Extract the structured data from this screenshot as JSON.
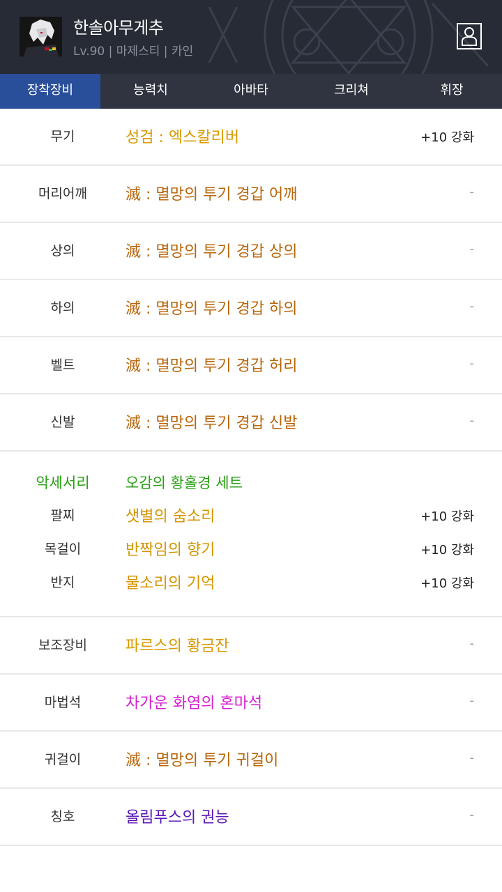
{
  "header": {
    "character_name": "한솔아무게추",
    "character_info": "Lv.90 | 마제스티 | 카인",
    "avatar_icon": "character-portrait-icon",
    "profile_icon": "profile-person-icon"
  },
  "tabs": [
    {
      "label": "장착장비",
      "active": true
    },
    {
      "label": "능력치",
      "active": false
    },
    {
      "label": "아바타",
      "active": false
    },
    {
      "label": "크리쳐",
      "active": false
    },
    {
      "label": "휘장",
      "active": false
    }
  ],
  "equipment": {
    "weapon": {
      "slot": "무기",
      "name": "성검 : 엑스칼리버",
      "upgrade": "+10 강화"
    },
    "shoulder": {
      "slot": "머리어깨",
      "name": "滅 : 멸망의 투기 경갑 어깨",
      "upgrade": "-"
    },
    "top": {
      "slot": "상의",
      "name": "滅 : 멸망의 투기 경갑 상의",
      "upgrade": "-"
    },
    "bottom": {
      "slot": "하의",
      "name": "滅 : 멸망의 투기 경갑 하의",
      "upgrade": "-"
    },
    "belt": {
      "slot": "벨트",
      "name": "滅 : 멸망의 투기 경갑 허리",
      "upgrade": "-"
    },
    "shoes": {
      "slot": "신발",
      "name": "滅 : 멸망의 투기 경갑 신발",
      "upgrade": "-"
    }
  },
  "accessory": {
    "slot": "악세서리",
    "set_name": "오감의 황홀경 세트",
    "items": [
      {
        "slot": "팔찌",
        "name": "샛별의 숨소리",
        "upgrade": "+10 강화"
      },
      {
        "slot": "목걸이",
        "name": "반짝임의 향기",
        "upgrade": "+10 강화"
      },
      {
        "slot": "반지",
        "name": "물소리의 기억",
        "upgrade": "+10 강화"
      }
    ]
  },
  "extra": {
    "sub": {
      "slot": "보조장비",
      "name": "파르스의 황금잔",
      "upgrade": "-"
    },
    "magicstone": {
      "slot": "마법석",
      "name": "차가운 화염의 혼마석",
      "upgrade": "-"
    },
    "earring": {
      "slot": "귀걸이",
      "name": "滅 : 멸망의 투기 귀걸이",
      "upgrade": "-"
    },
    "title": {
      "slot": "칭호",
      "name": "올림푸스의 권능",
      "upgrade": "-"
    }
  },
  "colors": {
    "epic": "#b8660b",
    "legendary": "#d89a00",
    "set": "#27a012",
    "magenta": "#d61fd0",
    "purple": "#5a16b5",
    "active_tab": "#2a4f9a"
  }
}
